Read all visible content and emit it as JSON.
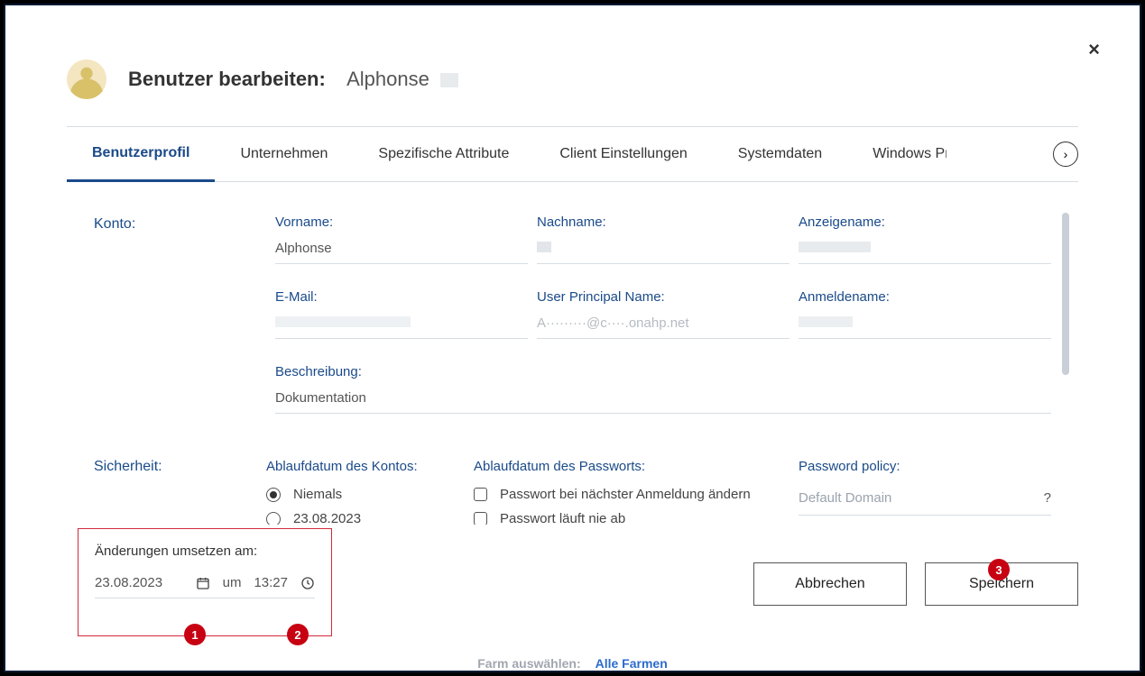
{
  "close_label": "×",
  "header": {
    "title_prefix": "Benutzer bearbeiten:",
    "user_name": "Alphonse"
  },
  "tabs": {
    "items": [
      {
        "label": "Benutzerprofil",
        "active": true
      },
      {
        "label": "Unternehmen"
      },
      {
        "label": "Spezifische Attribute"
      },
      {
        "label": "Client Einstellungen"
      },
      {
        "label": "Systemdaten"
      },
      {
        "label": "Windows Pr"
      }
    ],
    "next_glyph": "›"
  },
  "konto": {
    "section_label": "Konto:",
    "vorname_label": "Vorname:",
    "vorname_value": "Alphonse",
    "nachname_label": "Nachname:",
    "nachname_value": "",
    "anzeigename_label": "Anzeigename:",
    "anzeigename_value": "",
    "email_label": "E-Mail:",
    "email_value": "",
    "upn_label": "User Principal Name:",
    "upn_value": "A·········@c····.onahp.net",
    "anmeldename_label": "Anmeldename:",
    "anmeldename_value": "",
    "beschreibung_label": "Beschreibung:",
    "beschreibung_value": "Dokumentation"
  },
  "sicherheit": {
    "section_label": "Sicherheit:",
    "konto_ablauf_label": "Ablaufdatum des Kontos:",
    "opt_niemals": "Niemals",
    "opt_datum": "23.08.2023",
    "pwd_ablauf_label": "Ablaufdatum des Passworts:",
    "opt_pwd_next": "Passwort bei nächster Anmeldung ändern",
    "opt_pwd_never": "Passwort läuft nie ab",
    "policy_label": "Password policy:",
    "policy_placeholder": "Default Domain",
    "policy_help": "?"
  },
  "schedule": {
    "label": "Änderungen umsetzen am:",
    "date": "23.08.2023",
    "um": "um",
    "time": "13:27"
  },
  "buttons": {
    "cancel": "Abbrechen",
    "save": "Speichern"
  },
  "badges": {
    "one": "1",
    "two": "2",
    "three": "3"
  },
  "strip": {
    "label": "Farm auswählen:",
    "value": "Alle Farmen"
  }
}
